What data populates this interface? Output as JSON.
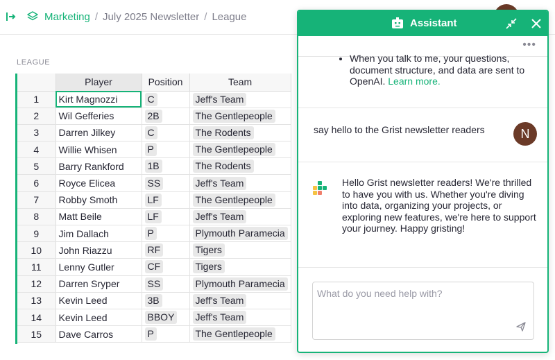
{
  "breadcrumb": {
    "workspace": "Marketing",
    "document": "July 2025 Newsletter",
    "page": "League",
    "separator": "/"
  },
  "section": {
    "title": "LEAGUE"
  },
  "table": {
    "columns": [
      "Player",
      "Position",
      "Team"
    ],
    "rows": [
      {
        "n": "1",
        "player": "Kirt Magnozzi",
        "position": "C",
        "team": "Jeff's Team"
      },
      {
        "n": "2",
        "player": "Wil Gefferies",
        "position": "2B",
        "team": "The Gentlepeople"
      },
      {
        "n": "3",
        "player": "Darren Jilkey",
        "position": "C",
        "team": "The Rodents"
      },
      {
        "n": "4",
        "player": "Willie Whisen",
        "position": "P",
        "team": "The Gentlepeople"
      },
      {
        "n": "5",
        "player": "Barry Rankford",
        "position": "1B",
        "team": "The Rodents"
      },
      {
        "n": "6",
        "player": "Royce Elicea",
        "position": "SS",
        "team": "Jeff's Team"
      },
      {
        "n": "7",
        "player": "Robby Smoth",
        "position": "LF",
        "team": "The Gentlepeople"
      },
      {
        "n": "8",
        "player": "Matt Beile",
        "position": "LF",
        "team": "Jeff's Team"
      },
      {
        "n": "9",
        "player": "Jim Dallach",
        "position": "P",
        "team": "Plymouth Paramecia"
      },
      {
        "n": "10",
        "player": "John Riazzu",
        "position": "RF",
        "team": "Tigers"
      },
      {
        "n": "11",
        "player": "Lenny Gutler",
        "position": "CF",
        "team": "Tigers"
      },
      {
        "n": "12",
        "player": "Darren Sryper",
        "position": "SS",
        "team": "Plymouth Paramecia"
      },
      {
        "n": "13",
        "player": "Kevin Leed",
        "position": "3B",
        "team": "Jeff's Team"
      },
      {
        "n": "14",
        "player": "Kevin Leed",
        "position": "BBOY",
        "team": "Jeff's Team"
      },
      {
        "n": "15",
        "player": "Dave Carros",
        "position": "P",
        "team": "The Gentlepeople"
      }
    ]
  },
  "assistant": {
    "title": "Assistant",
    "more_label": "•••",
    "info_text": "When you talk to me, your questions, document structure, and data are sent to OpenAI.",
    "learn_more": "Learn more.",
    "user_message": "say hello to the Grist newsletter readers",
    "user_initial": "N",
    "bot_message": "Hello Grist newsletter readers! We're thrilled to have you with us. Whether you're diving into data, organizing your projects, or exploring new features, we're here to support your journey. Happy gristing!",
    "input_placeholder": "What do you need help with?",
    "input_value": ""
  },
  "colors": {
    "accent": "#16b378",
    "avatar": "#6b3a28",
    "chip": "#e8e8e8"
  }
}
